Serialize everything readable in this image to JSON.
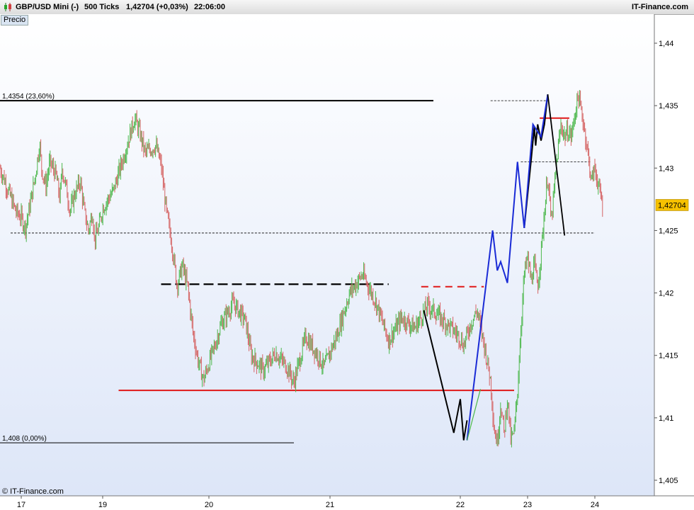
{
  "header": {
    "symbol": "GBP/USD Mini (-)",
    "period": "500 Ticks",
    "last_change": "1,42704 (+0,03%)",
    "time": "22:06:00",
    "brand": "IT-Finance.com"
  },
  "panel": {
    "label": "Precio"
  },
  "footer": {
    "copyright": "© IT-Finance.com"
  },
  "colors": {
    "background_top": "#ffffff",
    "background_bottom": "#dde6f8",
    "up_candle": "#4cb84c",
    "down_candle": "#d56464",
    "price_tag": "#f6c100",
    "red_line": "#e01818",
    "blue_line": "#1a2bd6"
  },
  "chart_data": {
    "type": "line",
    "ylim": [
      1.4035,
      1.4445
    ],
    "y_ticks": [
      "1,405",
      "1,41",
      "1,415",
      "1,42",
      "1,425",
      "1,43",
      "1,435",
      "1,44"
    ],
    "y_tick_values": [
      1.405,
      1.41,
      1.415,
      1.42,
      1.425,
      1.43,
      1.435,
      1.44
    ],
    "xlim": [
      16.8,
      24.6
    ],
    "x_ticks": [
      "17",
      "19",
      "20",
      "21",
      "22",
      "23",
      "24"
    ],
    "x_tick_values": [
      17,
      19,
      20,
      21,
      22,
      23,
      24
    ],
    "last_price": 1.42704,
    "last_price_label": "1,42704",
    "fib_levels": [
      {
        "label": "1,4354 (23,60%)",
        "value": 1.4354
      },
      {
        "label": "1,408 (0,00%)",
        "value": 1.408
      }
    ],
    "series": [
      {
        "values": [
          [
            16.8,
            1.43
          ],
          [
            16.95,
            1.4265
          ],
          [
            17.1,
            1.4252
          ],
          [
            17.2,
            1.4268
          ],
          [
            17.35,
            1.4295
          ],
          [
            17.45,
            1.432
          ],
          [
            17.5,
            1.43
          ],
          [
            17.6,
            1.4285
          ],
          [
            17.7,
            1.4305
          ],
          [
            17.85,
            1.4295
          ],
          [
            17.95,
            1.4275
          ],
          [
            18.0,
            1.43
          ],
          [
            18.1,
            1.4285
          ],
          [
            18.2,
            1.4265
          ],
          [
            18.3,
            1.4278
          ],
          [
            18.45,
            1.429
          ],
          [
            18.55,
            1.4265
          ],
          [
            18.65,
            1.425
          ],
          [
            18.75,
            1.4265
          ],
          [
            18.8,
            1.4242
          ],
          [
            18.9,
            1.4252
          ],
          [
            19.0,
            1.4268
          ],
          [
            19.1,
            1.4282
          ],
          [
            19.2,
            1.431
          ],
          [
            19.3,
            1.434
          ],
          [
            19.35,
            1.4328
          ],
          [
            19.4,
            1.4312
          ],
          [
            19.5,
            1.4318
          ],
          [
            19.55,
            1.4302
          ],
          [
            19.6,
            1.4265
          ],
          [
            19.65,
            1.424
          ],
          [
            19.7,
            1.4206
          ],
          [
            19.75,
            1.4222
          ],
          [
            19.8,
            1.4205
          ],
          [
            19.85,
            1.4168
          ],
          [
            19.9,
            1.4145
          ],
          [
            19.95,
            1.413
          ],
          [
            20.05,
            1.4158
          ],
          [
            20.1,
            1.4175
          ],
          [
            20.2,
            1.4192
          ],
          [
            20.3,
            1.4178
          ],
          [
            20.35,
            1.415
          ],
          [
            20.45,
            1.4138
          ],
          [
            20.55,
            1.4152
          ],
          [
            20.65,
            1.414
          ],
          [
            20.7,
            1.4128
          ],
          [
            20.8,
            1.4165
          ],
          [
            20.9,
            1.415
          ],
          [
            20.95,
            1.414
          ],
          [
            21.05,
            1.4165
          ],
          [
            21.15,
            1.42
          ],
          [
            21.25,
            1.4215
          ],
          [
            21.35,
            1.4193
          ],
          [
            21.45,
            1.4162
          ],
          [
            21.55,
            1.418
          ],
          [
            21.65,
            1.4172
          ],
          [
            21.75,
            1.419
          ],
          [
            21.85,
            1.418
          ],
          [
            21.95,
            1.417
          ],
          [
            22.05,
            1.4158
          ],
          [
            22.15,
            1.4175
          ],
          [
            22.25,
            1.4186
          ],
          [
            22.35,
            1.416
          ],
          [
            22.45,
            1.413
          ],
          [
            22.5,
            1.4092
          ],
          [
            22.55,
            1.408
          ],
          [
            22.6,
            1.4112
          ],
          [
            22.65,
            1.4087
          ],
          [
            22.7,
            1.4116
          ],
          [
            22.75,
            1.4082
          ],
          [
            22.8,
            1.4088
          ],
          [
            22.85,
            1.4122
          ],
          [
            22.9,
            1.4172
          ],
          [
            22.95,
            1.4215
          ],
          [
            23.0,
            1.4228
          ],
          [
            23.05,
            1.421
          ],
          [
            23.1,
            1.4222
          ],
          [
            23.15,
            1.4205
          ],
          [
            23.2,
            1.4232
          ],
          [
            23.25,
            1.4265
          ],
          [
            23.3,
            1.4295
          ],
          [
            23.35,
            1.4256
          ],
          [
            23.4,
            1.4285
          ],
          [
            23.45,
            1.4315
          ],
          [
            23.5,
            1.4335
          ],
          [
            23.55,
            1.4325
          ],
          [
            23.6,
            1.433
          ],
          [
            23.65,
            1.4325
          ],
          [
            23.7,
            1.4342
          ],
          [
            23.75,
            1.4358
          ],
          [
            23.8,
            1.4345
          ],
          [
            23.85,
            1.433
          ],
          [
            23.9,
            1.431
          ],
          [
            23.95,
            1.429
          ],
          [
            24.0,
            1.43
          ],
          [
            24.05,
            1.428
          ],
          [
            24.08,
            1.42704
          ]
        ]
      }
    ],
    "zigzag_black": [
      [
        21.72,
        1.4186
      ],
      [
        21.95,
        1.4088
      ],
      [
        22.0,
        1.4115
      ],
      [
        22.05,
        1.4082
      ],
      [
        22.1,
        1.4098
      ]
    ],
    "zigzag_blue": [
      [
        22.1,
        1.4082
      ],
      [
        22.48,
        1.425
      ],
      [
        22.55,
        1.4218
      ],
      [
        22.6,
        1.4225
      ],
      [
        22.7,
        1.4208
      ],
      [
        22.85,
        1.4305
      ],
      [
        22.95,
        1.4252
      ],
      [
        23.08,
        1.4335
      ],
      [
        23.2,
        1.4325
      ],
      [
        23.3,
        1.4359
      ]
    ],
    "zigzag_black_2": [
      [
        23.3,
        1.4359
      ],
      [
        23.55,
        1.4246
      ]
    ],
    "zigzag_upper_black": [
      [
        22.95,
        1.4252
      ],
      [
        23.05,
        1.4305
      ],
      [
        23.1,
        1.4333
      ],
      [
        23.12,
        1.4318
      ],
      [
        23.15,
        1.4335
      ],
      [
        23.2,
        1.4322
      ],
      [
        23.25,
        1.4335
      ],
      [
        23.3,
        1.4359
      ]
    ],
    "red_levels": [
      {
        "x1": 19.15,
        "x2": 22.8,
        "y": 1.4122,
        "dashed": false
      },
      {
        "x1": 21.7,
        "x2": 22.35,
        "y": 1.4205,
        "dashed": true
      },
      {
        "x1": 23.18,
        "x2": 23.62,
        "y": 1.434,
        "dashed": false
      }
    ],
    "black_levels": [
      {
        "x1": 19.55,
        "x2": 21.45,
        "y": 1.4207,
        "dashed": true,
        "heavy": true
      },
      {
        "x1": 16.9,
        "x2": 18.6,
        "y": 1.4248,
        "dashed": true,
        "heavy": false
      },
      {
        "x1": 18.65,
        "x2": 24.0,
        "y": 1.4248,
        "dashed": true,
        "heavy": false
      },
      {
        "x1": 22.9,
        "x2": 23.95,
        "y": 1.4305,
        "dashed": true,
        "heavy": false
      },
      {
        "x1": 22.45,
        "x2": 23.3,
        "y": 1.4354,
        "dashed": true,
        "heavy": false
      }
    ]
  }
}
